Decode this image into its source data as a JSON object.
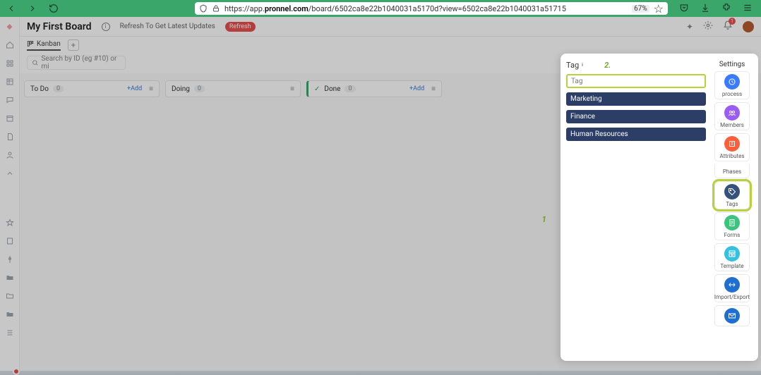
{
  "browser": {
    "url_prefix": "https://app.",
    "url_domain": "pronnel.com",
    "url_path": "/board/6502ca8e22b1040031a5170d?view=6502ca8e22b1040031a51715",
    "zoom": "67%"
  },
  "header": {
    "title": "My First Board",
    "refresh_text": "Refresh To Get Latest Updates",
    "refresh_btn": "Refresh",
    "notif_count": "1"
  },
  "tabs": {
    "kanban": "Kanban"
  },
  "search": {
    "placeholder": "Search by ID (eg #10) or mi"
  },
  "columns": [
    {
      "name": "To Do",
      "count": "0",
      "add": "+Add"
    },
    {
      "name": "Doing",
      "count": "0"
    },
    {
      "name": "Done",
      "count": "0",
      "add": "+Add",
      "done": true
    }
  ],
  "annotation": {
    "one": "1",
    "two": "2."
  },
  "panel": {
    "tag_title": "Tag",
    "tag_input_placeholder": "Tag",
    "tags": [
      "Marketing",
      "Finance",
      "Human Resources"
    ],
    "settings_title": "Settings",
    "tiles": {
      "process": "process",
      "members": "Members",
      "attributes": "Attributes",
      "phases": "Phases",
      "tags": "Tags",
      "forms": "Forms",
      "template": "Template",
      "import": "Import/Export"
    }
  }
}
